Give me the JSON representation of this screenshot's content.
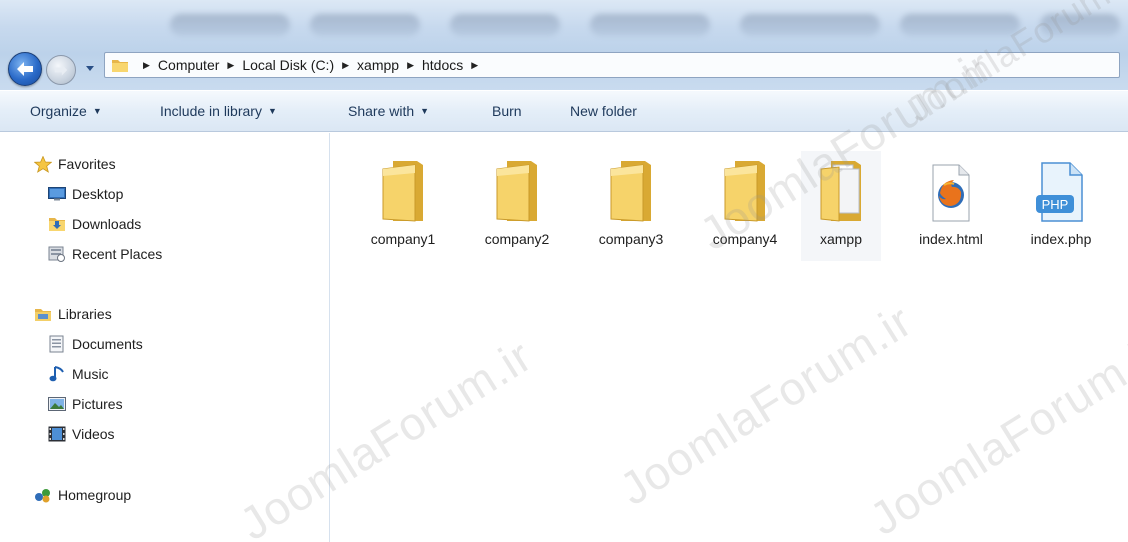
{
  "address_bar": {
    "crumbs": [
      "Computer",
      "Local Disk (C:)",
      "xampp",
      "htdocs"
    ]
  },
  "command_bar": {
    "organize": "Organize",
    "include_in_library": "Include in library",
    "share_with": "Share with",
    "burn": "Burn",
    "new_folder": "New folder"
  },
  "nav": {
    "favorites": {
      "label": "Favorites",
      "items": [
        {
          "label": "Desktop",
          "icon": "desktop-icon"
        },
        {
          "label": "Downloads",
          "icon": "downloads-folder-icon"
        },
        {
          "label": "Recent Places",
          "icon": "recent-places-icon"
        }
      ]
    },
    "libraries": {
      "label": "Libraries",
      "items": [
        {
          "label": "Documents",
          "icon": "documents-icon"
        },
        {
          "label": "Music",
          "icon": "music-icon"
        },
        {
          "label": "Pictures",
          "icon": "pictures-icon"
        },
        {
          "label": "Videos",
          "icon": "videos-icon"
        }
      ]
    },
    "homegroup": {
      "label": "Homegroup",
      "icon": "homegroup-icon"
    }
  },
  "files": [
    {
      "name": "company1",
      "type": "folder"
    },
    {
      "name": "company2",
      "type": "folder"
    },
    {
      "name": "company3",
      "type": "folder"
    },
    {
      "name": "company4",
      "type": "folder"
    },
    {
      "name": "xampp",
      "type": "folder-with-files"
    },
    {
      "name": "index.html",
      "type": "firefox-html-file"
    },
    {
      "name": "index.php",
      "type": "php-file"
    }
  ],
  "watermark": "JoomlaForum.ir",
  "colors": {
    "command_text": "#1e395b",
    "folder_yellow": "#f6d36a",
    "php_blue": "#3f8fd8"
  }
}
